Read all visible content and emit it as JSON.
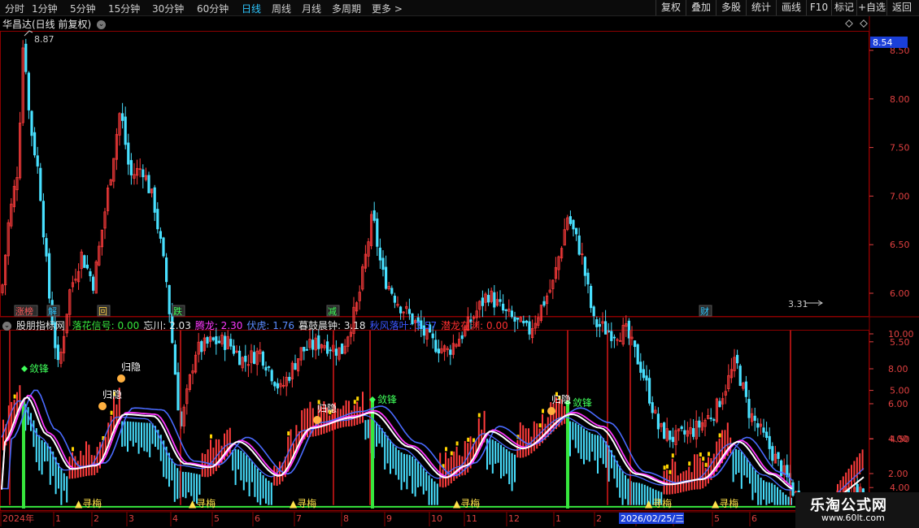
{
  "toolbar": {
    "periods": [
      "分时",
      "1分钟",
      "5分钟",
      "15分钟",
      "30分钟",
      "60分钟",
      "日线",
      "周线",
      "月线",
      "多周期",
      "更多 >"
    ],
    "active_period": "日线",
    "right_buttons": [
      "复权",
      "叠加",
      "多股",
      "统计",
      "画线",
      "F10",
      "标记",
      "+自选",
      "返回"
    ]
  },
  "price_panel": {
    "title": "华昌达(日线 前复权)",
    "current_price_tag": "8.54",
    "high_label": "8.87",
    "low_label": "3.31",
    "y_ticks": [
      "8.50",
      "8.00",
      "7.50",
      "7.00",
      "6.50",
      "6.00",
      "5.50",
      "5.00",
      "4.50",
      "4.00",
      "3.50"
    ],
    "event_markers": [
      {
        "text": "涨榜",
        "color": "#ff5a5a"
      },
      {
        "text": "解",
        "color": "#2ec7ff"
      },
      {
        "text": "回",
        "color": "#ffd24a"
      },
      {
        "text": "跌",
        "color": "#3fff5a"
      },
      {
        "text": "减",
        "color": "#3fff5a"
      },
      {
        "text": "财",
        "color": "#2ec7ff"
      }
    ]
  },
  "indicator_panel": {
    "name": "股朋指标网",
    "values": [
      {
        "label": "落花信号:",
        "value": "0.00",
        "color": "#37e63d"
      },
      {
        "label": "忘川:",
        "value": "2.03",
        "color": "#e6e6e6"
      },
      {
        "label": "腾龙:",
        "value": "2.30",
        "color": "#ff39ff"
      },
      {
        "label": "伏虎:",
        "value": "1.76",
        "color": "#5a8cff"
      },
      {
        "label": "暮鼓晨钟:",
        "value": "3.18",
        "color": "#e6e6e6"
      },
      {
        "label": "秋风落叶:",
        "value": "3.57",
        "color": "#3b57ff"
      },
      {
        "label": "潜龙在渊:",
        "value": "0.00",
        "color": "#ff3030"
      }
    ],
    "y_ticks": [
      "10.00",
      "8.00",
      "6.00",
      "4.00",
      "2.00"
    ],
    "annotations": {
      "sword": "敛锋",
      "retreat": "归隐",
      "seek": "▲寻梅"
    }
  },
  "time_axis": {
    "labels": [
      "2024年",
      "1",
      "2",
      "3",
      "4",
      "5",
      "6",
      "7",
      "8",
      "9",
      "10",
      "11",
      "12",
      "1",
      "2",
      "3",
      "4",
      "5",
      "6"
    ],
    "cursor_date": "2026/02/25/三"
  },
  "watermark": {
    "site_name": "乐淘公式网",
    "url": "www.60lt.com"
  },
  "colors": {
    "up": "#ff3c3c",
    "down": "#48e0ff",
    "white_line": "#ffffff",
    "magenta": "#ff39ff",
    "blue": "#4a6bff",
    "green_bar": "#37e63d",
    "grid": "#8b0000",
    "axis_text": "#e04040"
  }
}
